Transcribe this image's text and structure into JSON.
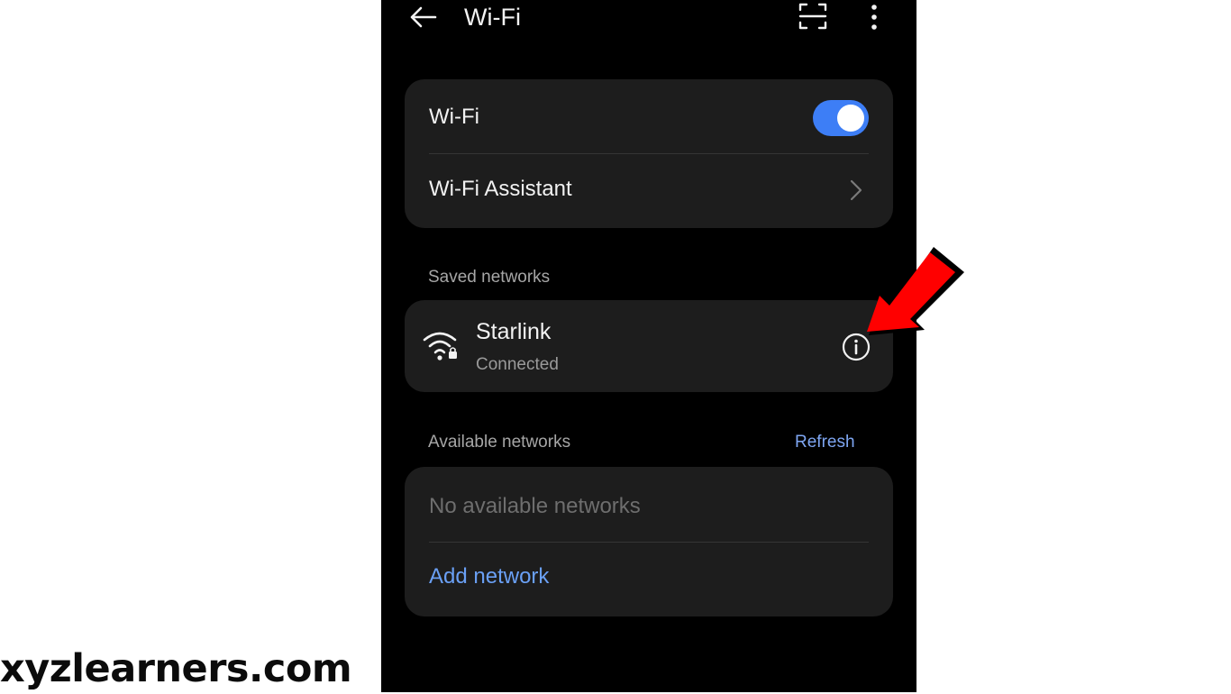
{
  "header": {
    "title": "Wi-Fi",
    "back_icon": "arrow-left-icon",
    "scan_icon": "qr-scan-icon",
    "more_icon": "more-vertical-icon"
  },
  "wifi_card": {
    "wifi_label": "Wi-Fi",
    "wifi_enabled": true,
    "assistant_label": "Wi-Fi Assistant",
    "assistant_icon": "chevron-right-icon"
  },
  "saved": {
    "section_label": "Saved networks",
    "network": {
      "name": "Starlink",
      "status": "Connected",
      "icon": "wifi-lock-icon",
      "info_icon": "info-icon"
    }
  },
  "available": {
    "section_label": "Available networks",
    "refresh_label": "Refresh",
    "empty_text": "No available networks",
    "add_label": "Add network"
  },
  "annotation": {
    "arrow_icon": "red-arrow-icon"
  },
  "watermark": "xyzlearners.com",
  "colors": {
    "background": "#000000",
    "card": "#1d1d1d",
    "accent": "#3d7ef6",
    "link": "#6aa0f5",
    "arrow": "#ff0000"
  }
}
